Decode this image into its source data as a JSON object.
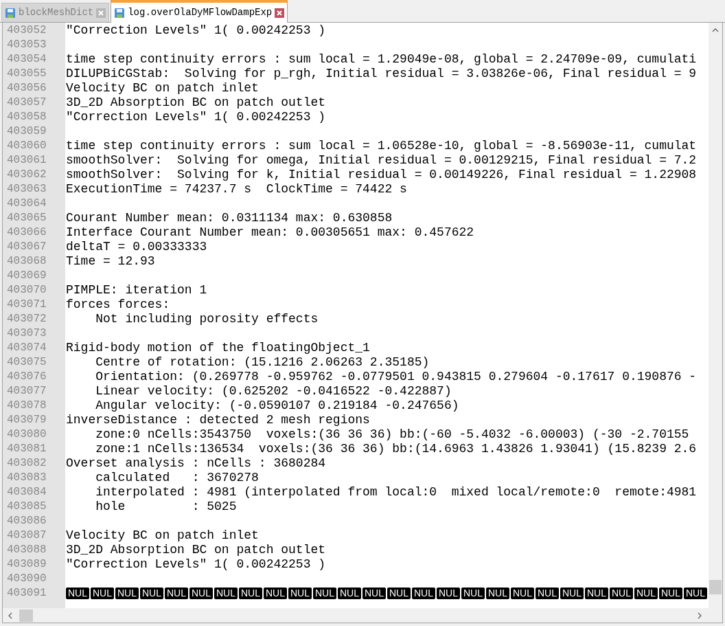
{
  "tabs": [
    {
      "label": "blockMeshDict",
      "selected": false
    },
    {
      "label": "log.overOlaDyMFlowDampExp",
      "selected": true
    }
  ],
  "lines": [
    {
      "number": "403052",
      "text": "\"Correction Levels\" 1( 0.00242253 )"
    },
    {
      "number": "403053"
    },
    {
      "number": "403054",
      "text": "time step continuity errors : sum local = 1.29049e-08, global = 2.24709e-09, cumulati"
    },
    {
      "number": "403055",
      "text": "DILUPBiCGStab:  Solving for p_rgh, Initial residual = 3.03826e-06, Final residual = 9"
    },
    {
      "number": "403056",
      "text": "Velocity BC on patch inlet"
    },
    {
      "number": "403057",
      "text": "3D_2D Absorption BC on patch outlet"
    },
    {
      "number": "403058",
      "text": "\"Correction Levels\" 1( 0.00242253 )"
    },
    {
      "number": "403059"
    },
    {
      "number": "403060",
      "text": "time step continuity errors : sum local = 1.06528e-10, global = -8.56903e-11, cumulat"
    },
    {
      "number": "403061",
      "text": "smoothSolver:  Solving for omega, Initial residual = 0.00129215, Final residual = 7.2"
    },
    {
      "number": "403062",
      "text": "smoothSolver:  Solving for k, Initial residual = 0.00149226, Final residual = 1.22908"
    },
    {
      "number": "403063",
      "text": "ExecutionTime = 74237.7 s  ClockTime = 74422 s"
    },
    {
      "number": "403064"
    },
    {
      "number": "403065",
      "text": "Courant Number mean: 0.0311134 max: 0.630858"
    },
    {
      "number": "403066",
      "text": "Interface Courant Number mean: 0.00305651 max: 0.457622"
    },
    {
      "number": "403067",
      "text": "deltaT = 0.00333333"
    },
    {
      "number": "403068",
      "text": "Time = 12.93"
    },
    {
      "number": "403069"
    },
    {
      "number": "403070",
      "text": "PIMPLE: iteration 1"
    },
    {
      "number": "403071",
      "text": "forces forces:"
    },
    {
      "number": "403072",
      "text": "    Not including porosity effects"
    },
    {
      "number": "403073"
    },
    {
      "number": "403074",
      "text": "Rigid-body motion of the floatingObject_1"
    },
    {
      "number": "403075",
      "text": "    Centre of rotation: (15.1216 2.06263 2.35185)"
    },
    {
      "number": "403076",
      "text": "    Orientation: (0.269778 -0.959762 -0.0779501 0.943815 0.279604 -0.17617 0.190876 -"
    },
    {
      "number": "403077",
      "text": "    Linear velocity: (0.625202 -0.0416522 -0.422887)"
    },
    {
      "number": "403078",
      "text": "    Angular velocity: (-0.0590107 0.219184 -0.247656)"
    },
    {
      "number": "403079",
      "text": "inverseDistance : detected 2 mesh regions"
    },
    {
      "number": "403080",
      "text": "    zone:0 nCells:3543750  voxels:(36 36 36) bb:(-60 -5.4032 -6.00003) (-30 -2.70155"
    },
    {
      "number": "403081",
      "text": "    zone:1 nCells:136534  voxels:(36 36 36) bb:(14.6963 1.43826 1.93041) (15.8239 2.6"
    },
    {
      "number": "403082",
      "text": "Overset analysis : nCells : 3680284"
    },
    {
      "number": "403083",
      "text": "    calculated   : 3670278"
    },
    {
      "number": "403084",
      "text": "    interpolated : 4981 (interpolated from local:0  mixed local/remote:0  remote:4981"
    },
    {
      "number": "403085",
      "text": "    hole         : 5025"
    },
    {
      "number": "403086"
    },
    {
      "number": "403087",
      "text": "Velocity BC on patch inlet"
    },
    {
      "number": "403088",
      "text": "3D_2D Absorption BC on patch outlet"
    },
    {
      "number": "403089",
      "text": "\"Correction Levels\" 1( 0.00242253 )"
    },
    {
      "number": "403090"
    },
    {
      "number": "403091",
      "nul_tokens": [
        "NUL",
        "NUL",
        "NUL",
        "NUL",
        "NUL",
        "NUL",
        "NUL",
        "NUL",
        "NUL",
        "NUL",
        "NUL",
        "NUL",
        "NUL",
        "NUL",
        "NUL",
        "NUL",
        "NUL",
        "NUL",
        "NUL",
        "NUL",
        "NUL",
        "NUL",
        "NUL",
        "NUL",
        "NUL",
        "NUL"
      ]
    }
  ]
}
